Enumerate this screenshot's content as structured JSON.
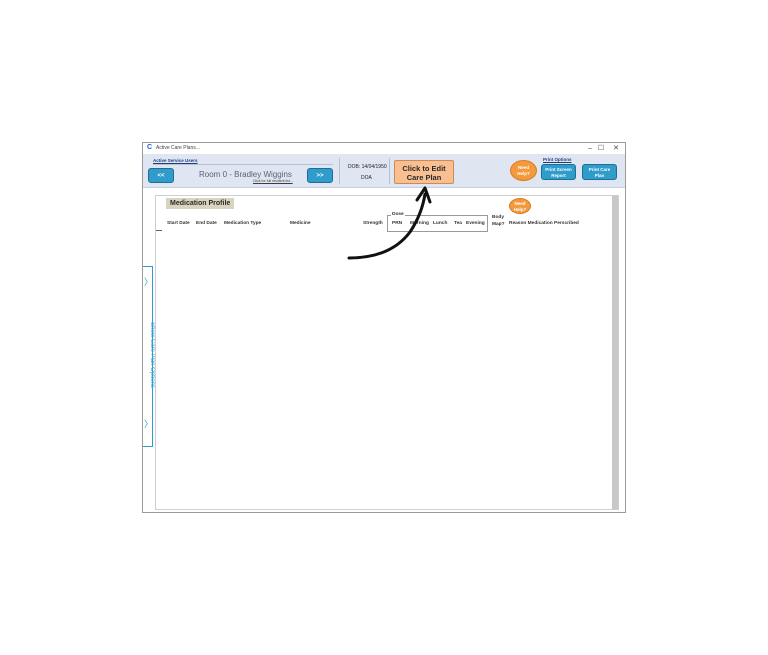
{
  "window": {
    "title": "Active Care Plans...",
    "app_icon": "C",
    "controls": {
      "minimize": "–",
      "maximize": "☐",
      "close": "✕"
    }
  },
  "header": {
    "active_service_users_label": "Active Service Users",
    "prev_label": "<<",
    "next_label": ">>",
    "resident_name": "Room 0 - Bradley Wiggins",
    "full_resident_link": "Click for full resident list...",
    "dob": "DOB: 14/04/1950",
    "doa": "DOA",
    "edit_line1": "Click to Edit",
    "edit_line2": "Care Plan",
    "need_help_line1": "Need",
    "need_help_line2": "Help?",
    "print_options_label": "Print Options",
    "print_screen_line1": "Print Screen",
    "print_screen_line2": "Report",
    "print_care_plan_line1": "Print Care",
    "print_care_plan_line2": "Plan"
  },
  "side_tab": {
    "label": "Show Care Plan Options",
    "chevron": "〉"
  },
  "medication": {
    "title": "Medication Profile",
    "need_help_line1": "Need",
    "need_help_line2": "Help?",
    "columns": {
      "start_date": "Start Date",
      "end_date": "End Date",
      "medication_type": "Medication Type",
      "medicine": "Medicine",
      "strength": "Strength",
      "dose": "Dose",
      "prn": "PRN",
      "morning": "Morning",
      "lunch": "Lunch",
      "tea": "Tea",
      "evening": "Evening",
      "body_map_line1": "Body",
      "body_map_line2": "Map?",
      "reason": "Reason Medication Perscribed"
    }
  },
  "colors": {
    "accent_blue": "#2f9ccc",
    "header_bg": "#dfe5f1",
    "edit_button": "#f9bf91",
    "help_orange": "#f39a3c",
    "title_tag": "#d9d4bf"
  }
}
